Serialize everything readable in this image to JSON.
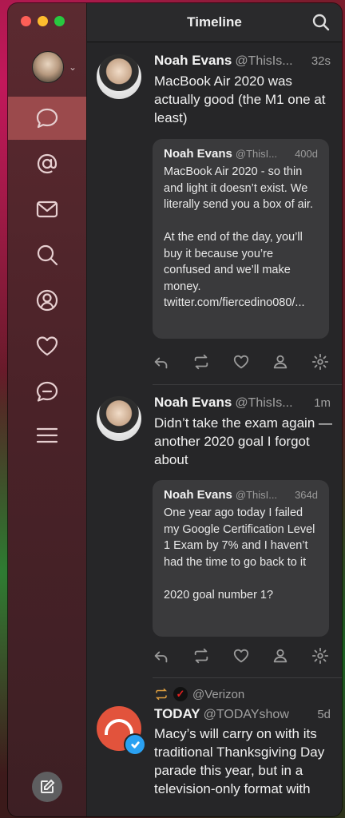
{
  "window": {
    "title": "Timeline"
  },
  "sidebar": {
    "items": [
      {
        "icon": "speech-bubble-icon",
        "active": true
      },
      {
        "icon": "at-mention-icon"
      },
      {
        "icon": "envelope-icon"
      },
      {
        "icon": "search-icon"
      },
      {
        "icon": "profile-icon"
      },
      {
        "icon": "heart-icon"
      },
      {
        "icon": "chat-dash-icon"
      },
      {
        "icon": "menu-icon"
      }
    ]
  },
  "tweets": [
    {
      "name": "Noah Evans",
      "handle": "@ThisIs...",
      "time": "32s",
      "text": "MacBook Air 2020 was actually good (the M1 one at least)",
      "quote": {
        "name": "Noah Evans",
        "handle": "@ThisI...",
        "time": "400d",
        "text": "MacBook Air 2020 - so thin and light it doesn’t exist. We literally send you a box of air.\n\nAt the end of the day, you’ll buy it because you’re confused and we’ll make money. twitter.com/fiercedino080/..."
      }
    },
    {
      "name": "Noah Evans",
      "handle": "@ThisIs...",
      "time": "1m",
      "text": "Didn’t take the exam again — another 2020 goal I forgot about",
      "quote": {
        "name": "Noah Evans",
        "handle": "@ThisI...",
        "time": "364d",
        "text": "One year ago today I failed my Google Certification Level 1 Exam by 7% and I haven’t had the time to go back to it\n\n2020 goal number 1?"
      }
    },
    {
      "retweeted_by": "@Verizon",
      "retweeter_badge": "✓",
      "name": "TODAY",
      "handle": "@TODAYshow",
      "time": "5d",
      "text": "Macy’s will carry on with its traditional Thanksgiving Day parade this year, but in a television-only format with"
    }
  ]
}
